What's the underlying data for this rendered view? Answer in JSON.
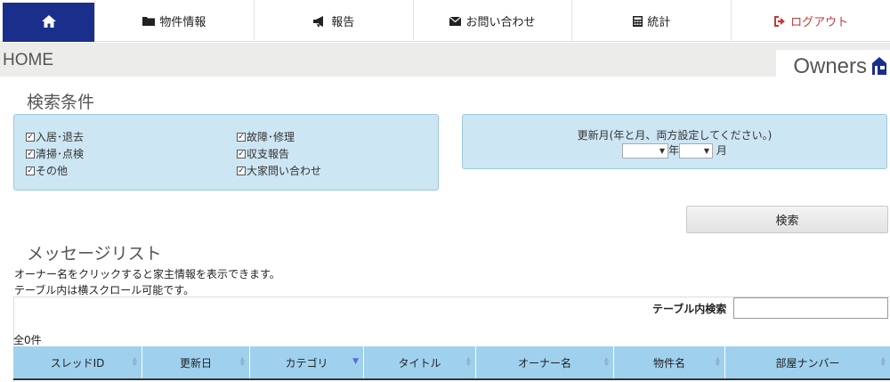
{
  "nav": {
    "items": [
      {
        "label": "物件情報"
      },
      {
        "label": "報告"
      },
      {
        "label": "お問い合わせ"
      },
      {
        "label": "統計"
      },
      {
        "label": "ログアウト"
      }
    ]
  },
  "header": {
    "title": "HOME",
    "brand": "Owners"
  },
  "search": {
    "heading": "検索条件",
    "categories": [
      {
        "label": "入居･退去",
        "checked": true
      },
      {
        "label": "清掃･点検",
        "checked": true
      },
      {
        "label": "その他",
        "checked": true
      },
      {
        "label": "故障･修理",
        "checked": true
      },
      {
        "label": "収支報告",
        "checked": true
      },
      {
        "label": "大家問い合わせ",
        "checked": true
      }
    ],
    "date_label": "更新月(年と月、両方設定してください。)",
    "year_unit": "年",
    "month_unit": "月",
    "year_value": "",
    "month_value": "",
    "button": "検索"
  },
  "messages": {
    "heading": "メッセージリスト",
    "note1": "オーナー名をクリックすると家主情報を表示できます。",
    "note2": "テーブル内は横スクロール可能です。",
    "table_search_label": "テーブル内検索",
    "table_search_value": "",
    "count": "全0件",
    "columns": [
      "スレッドID",
      "更新日",
      "カテゴリ",
      "タイトル",
      "オーナー名",
      "物件名",
      "部屋ナンバー"
    ],
    "sorted_column": "カテゴリ"
  },
  "colors": {
    "nav_home": "#1a2f8c",
    "panel": "#cde6f3",
    "table_header": "#9fd1ef",
    "logout": "#c23b3b"
  }
}
